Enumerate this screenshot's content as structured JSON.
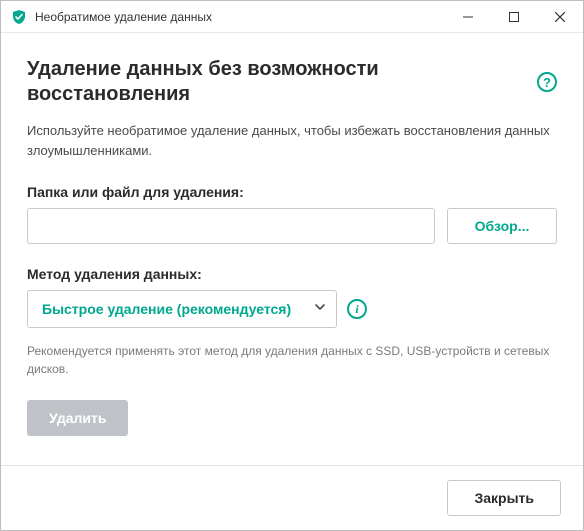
{
  "window": {
    "title": "Необратимое удаление данных"
  },
  "main": {
    "heading": "Удаление данных без возможности восстановления",
    "description": "Используйте необратимое удаление данных, чтобы избежать восстановления данных злоумышленниками.",
    "path_label": "Папка или файл для удаления:",
    "path_value": "",
    "path_placeholder": "",
    "browse_label": "Обзор...",
    "method_label": "Метод удаления данных:",
    "method_selected": "Быстрое удаление (рекомендуется)",
    "method_note": "Рекомендуется применять этот метод для удаления данных с SSD, USB-устройств и сетевых дисков.",
    "delete_label": "Удалить"
  },
  "footer": {
    "close_label": "Закрыть"
  },
  "icons": {
    "help_glyph": "?",
    "info_glyph": "i"
  },
  "colors": {
    "accent": "#00a88e",
    "disabled": "#bfc3c7"
  }
}
